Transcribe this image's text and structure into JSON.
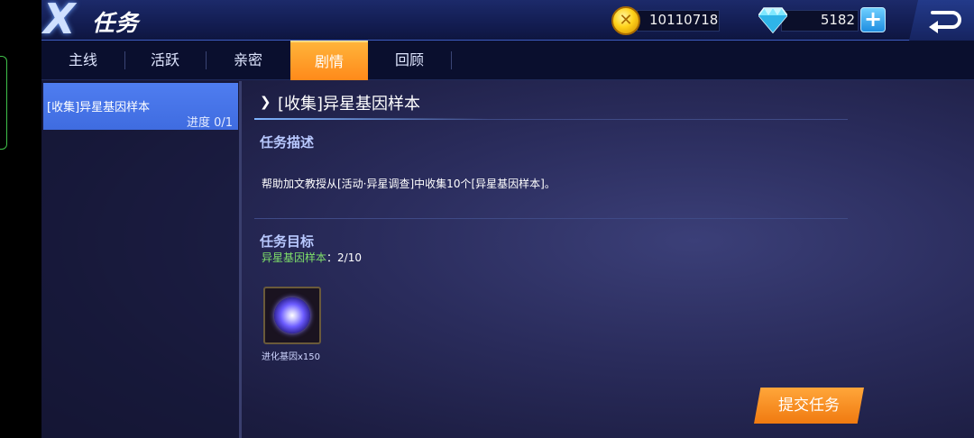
{
  "header": {
    "logo": "X",
    "title": "任务",
    "gold": "10110718",
    "diamonds": "5182",
    "add_label": "+"
  },
  "tabs": [
    {
      "label": "主线",
      "active": false
    },
    {
      "label": "活跃",
      "active": false
    },
    {
      "label": "亲密",
      "active": false
    },
    {
      "label": "剧情",
      "active": true
    },
    {
      "label": "回顾",
      "active": false
    }
  ],
  "quest_list": [
    {
      "name": "[收集]异星基因样本",
      "progress": "进度 0/1",
      "selected": true
    }
  ],
  "detail": {
    "title": "[收集]异星基因样本",
    "desc_heading": "任务描述",
    "description": "帮助加文教授从[活动·异星调查]中收集10个[异星基因样本]。",
    "objective_heading": "任务目标",
    "objective_name": "异星基因样本",
    "objective_count": "：2/10",
    "reward_label": "进化基因x150",
    "submit_label": "提交任务"
  },
  "icons": {
    "gold": "gold-coin-icon",
    "diamond": "diamond-icon",
    "back": "back-arrow-icon",
    "reward": "evolution-gene-orb-icon"
  },
  "colors": {
    "tab_active": "#ff9a2a",
    "list_selected": "#4a78ec",
    "objective_green": "#7fe06a",
    "section_heading": "#b9c9ff",
    "submit": "#f58a1e"
  }
}
